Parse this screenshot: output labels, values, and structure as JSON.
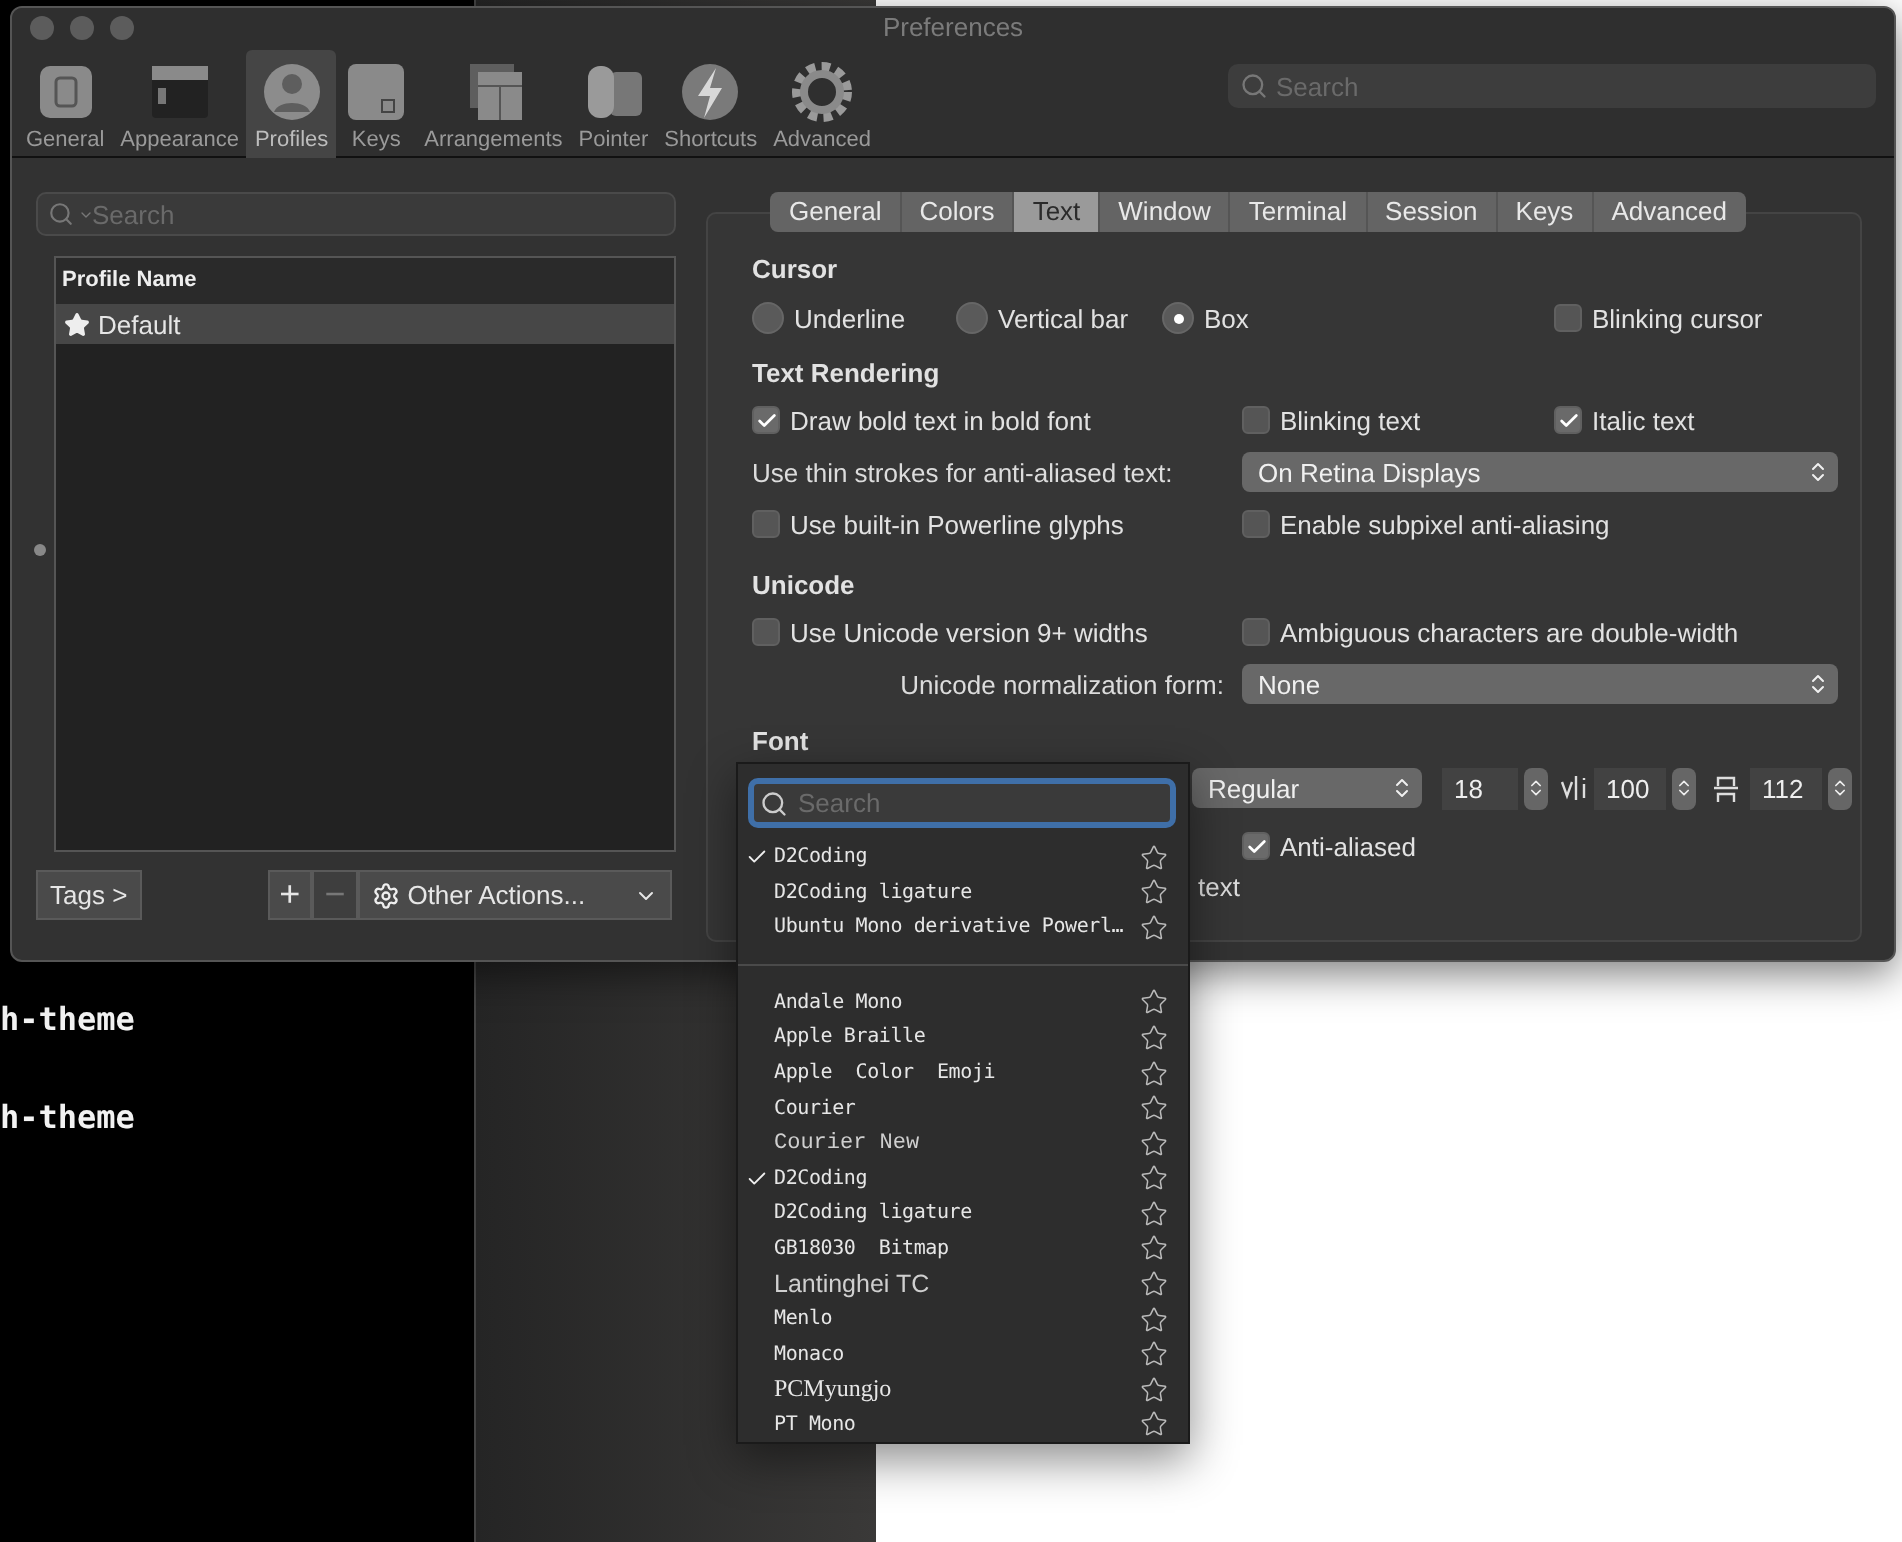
{
  "window": {
    "title": "Preferences"
  },
  "toolbar": [
    {
      "label": "General",
      "selected": false
    },
    {
      "label": "Appearance",
      "selected": false
    },
    {
      "label": "Profiles",
      "selected": true
    },
    {
      "label": "Keys",
      "selected": false
    },
    {
      "label": "Arrangements",
      "selected": false
    },
    {
      "label": "Pointer",
      "selected": false
    },
    {
      "label": "Shortcuts",
      "selected": false
    },
    {
      "label": "Advanced",
      "selected": false
    }
  ],
  "toolbar_search": {
    "placeholder": "Search"
  },
  "profiles": {
    "search": {
      "placeholder": "Search"
    },
    "column": "Profile Name",
    "rows": [
      {
        "name": "Default",
        "selected": true
      }
    ],
    "tags_button": "Tags >",
    "add": "+",
    "remove": "−",
    "other_actions": "Other Actions..."
  },
  "tabs": [
    {
      "label": "General",
      "selected": false
    },
    {
      "label": "Colors",
      "selected": false
    },
    {
      "label": "Text",
      "selected": true
    },
    {
      "label": "Window",
      "selected": false
    },
    {
      "label": "Terminal",
      "selected": false
    },
    {
      "label": "Session",
      "selected": false
    },
    {
      "label": "Keys",
      "selected": false
    },
    {
      "label": "Advanced",
      "selected": false
    }
  ],
  "cursor": {
    "heading": "Cursor",
    "options": [
      {
        "label": "Underline",
        "selected": false
      },
      {
        "label": "Vertical bar",
        "selected": false
      },
      {
        "label": "Box",
        "selected": true
      }
    ],
    "blinking": {
      "label": "Blinking cursor",
      "checked": false
    }
  },
  "text_rendering": {
    "heading": "Text Rendering",
    "checks": [
      {
        "label": "Draw bold text in bold font",
        "checked": true
      },
      {
        "label": "Blinking text",
        "checked": false
      },
      {
        "label": "Italic text",
        "checked": true
      }
    ],
    "thin_strokes": {
      "label": "Use thin strokes for anti-aliased text:",
      "value": "On Retina Displays"
    },
    "more_checks": [
      {
        "label": "Use built-in Powerline glyphs",
        "checked": false
      },
      {
        "label": "Enable subpixel anti-aliasing",
        "checked": false
      }
    ]
  },
  "unicode": {
    "heading": "Unicode",
    "checks": [
      {
        "label": "Use Unicode version 9+ widths",
        "checked": false
      },
      {
        "label": "Ambiguous characters are double-width",
        "checked": false
      }
    ],
    "normalization": {
      "label": "Unicode normalization form:",
      "value": "None"
    }
  },
  "font": {
    "heading": "Font",
    "style": "Regular",
    "size": "18",
    "h_spacing": "100",
    "v_spacing": "112",
    "anti_aliased": {
      "label": "Anti-aliased",
      "checked": true
    },
    "partial_label": "text"
  },
  "font_menu": {
    "search": {
      "placeholder": "Search"
    },
    "recent": [
      {
        "name": "D2Coding",
        "checked": true,
        "kind": "mono"
      },
      {
        "name": "D2Coding ligature",
        "checked": false,
        "kind": "mono"
      },
      {
        "name": "Ubuntu Mono derivative Powerl…",
        "checked": false,
        "kind": "mono"
      }
    ],
    "all": [
      {
        "name": "Andale Mono",
        "checked": false,
        "kind": "mono"
      },
      {
        "name": "Apple Braille",
        "checked": false,
        "kind": "mono"
      },
      {
        "name": "Apple  Color  Emoji",
        "checked": false,
        "kind": "mono"
      },
      {
        "name": "Courier",
        "checked": false,
        "kind": "mono"
      },
      {
        "name": "Courier New",
        "checked": false,
        "kind": "thin"
      },
      {
        "name": "D2Coding",
        "checked": true,
        "kind": "mono"
      },
      {
        "name": "D2Coding ligature",
        "checked": false,
        "kind": "mono"
      },
      {
        "name": "GB18030  Bitmap",
        "checked": false,
        "kind": "mono"
      },
      {
        "name": "Lantinghei TC",
        "checked": false,
        "kind": "sans"
      },
      {
        "name": "Menlo",
        "checked": false,
        "kind": "mono"
      },
      {
        "name": "Monaco",
        "checked": false,
        "kind": "mono"
      },
      {
        "name": "PCMyungjo",
        "checked": false,
        "kind": "serif"
      },
      {
        "name": "PT Mono",
        "checked": false,
        "kind": "mono"
      }
    ]
  },
  "terminal": {
    "lines": [
      "h-theme",
      "h-theme"
    ]
  }
}
